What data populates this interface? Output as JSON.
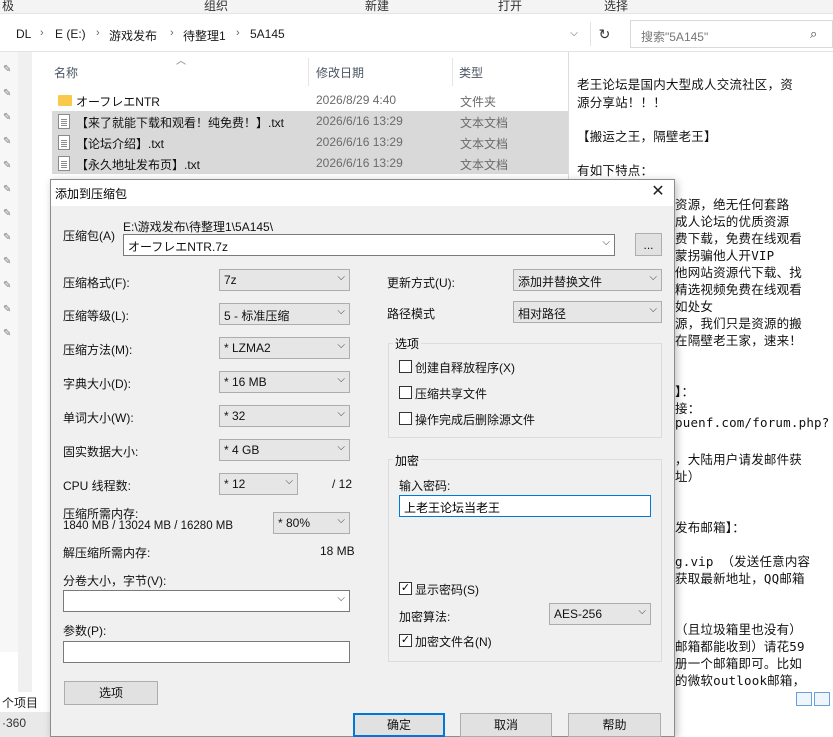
{
  "ribbon": {
    "left": "极",
    "group": "组织",
    "new": "新建",
    "open": "打开",
    "select": "选择"
  },
  "address": {
    "crumbs": [
      "DL",
      "E (E:)",
      "游戏发布",
      "待整理1",
      "5A145"
    ],
    "search_placeholder": "搜索\"5A145\""
  },
  "columns": {
    "name": "名称",
    "date": "修改日期",
    "type": "类型"
  },
  "files": [
    {
      "name": "オーフレエNTR",
      "date": "2026/8/29 4:40",
      "type": "文件夹",
      "icon": "folder-icon",
      "selected": false
    },
    {
      "name": "【来了就能下载和观看！纯免费！】.txt",
      "date": "2026/6/16 13:29",
      "type": "文本文档",
      "icon": "text-file-icon",
      "selected": true
    },
    {
      "name": "【论坛介绍】.txt",
      "date": "2026/6/16 13:29",
      "type": "文本文档",
      "icon": "text-file-icon",
      "selected": true
    },
    {
      "name": "【永久地址发布页】.txt",
      "date": "2026/6/16 13:29",
      "type": "文本文档",
      "icon": "text-file-icon",
      "selected": true
    }
  ],
  "status": {
    "count": "个项目",
    "taskbar": "·360"
  },
  "notepad": {
    "lines": [
      "老王论坛是国内大型成人交流社区，资",
      "源分享站！！！",
      "【搬运之王，隔壁老王】",
      "有如下特点：",
      "资源，绝无任何套路",
      "成人论坛的优质资源",
      "费下载，免费在线观看",
      "蒙拐骗他人开VIP",
      "他网站资源代下载、找",
      "精选视频免费在线观看",
      "如处女",
      "源，我们只是资源的搬",
      "在隔壁老王家，速来！",
      "】：",
      "接：",
      "puenf.com/forum.php?",
      "，大陆用户请发邮件获",
      "址）",
      "发布邮箱】：",
      "g.vip  （发送任意内容",
      "获取最新地址，QQ邮箱",
      "（且垃圾箱里也没有）",
      "邮箱都能收到）请花59",
      "册一个邮箱即可。比如",
      "的微软outlook邮箱，"
    ]
  },
  "dialog": {
    "title": "添加到压缩包",
    "archive_label": "压缩包(A)",
    "archive_path": "E:\\游戏发布\\待整理1\\5A145\\",
    "archive_name": "オーフレエNTR.7z",
    "browse_label": "...",
    "format_label": "压缩格式(F):",
    "format_value": "7z",
    "level_label": "压缩等级(L):",
    "level_value": "5 - 标准压缩",
    "method_label": "压缩方法(M):",
    "method_value": "* LZMA2",
    "dict_label": "字典大小(D):",
    "dict_value": "* 16 MB",
    "word_label": "单词大小(W):",
    "word_value": "* 32",
    "solid_label": "固实数据大小:",
    "solid_value": "* 4 GB",
    "cpu_label": "CPU 线程数:",
    "cpu_value": "* 12",
    "cpu_total": "/ 12",
    "mem_label": "压缩所需内存:",
    "mem_detail": "1840 MB / 13024 MB / 16280 MB",
    "mem_value": "* 80%",
    "decomp_label": "解压缩所需内存:",
    "decomp_value": "18 MB",
    "volume_label": "分卷大小，字节(V):",
    "volume_value": "",
    "params_label": "参数(P):",
    "params_value": "",
    "options_button": "选项",
    "update_label": "更新方式(U):",
    "update_value": "添加并替换文件",
    "path_label": "路径模式",
    "path_value": "相对路径",
    "options_group": "选项",
    "opt_sfx": "创建自释放程序(X)",
    "opt_shared": "压缩共享文件",
    "opt_delete": "操作完成后删除源文件",
    "encrypt_group": "加密",
    "password_label": "输入密码:",
    "password_value": "上老王论坛当老王",
    "show_password": "显示密码(S)",
    "enc_method_label": "加密算法:",
    "enc_method_value": "AES-256",
    "encrypt_names": "加密文件名(N)",
    "ok": "确定",
    "cancel": "取消",
    "help": "帮助"
  }
}
